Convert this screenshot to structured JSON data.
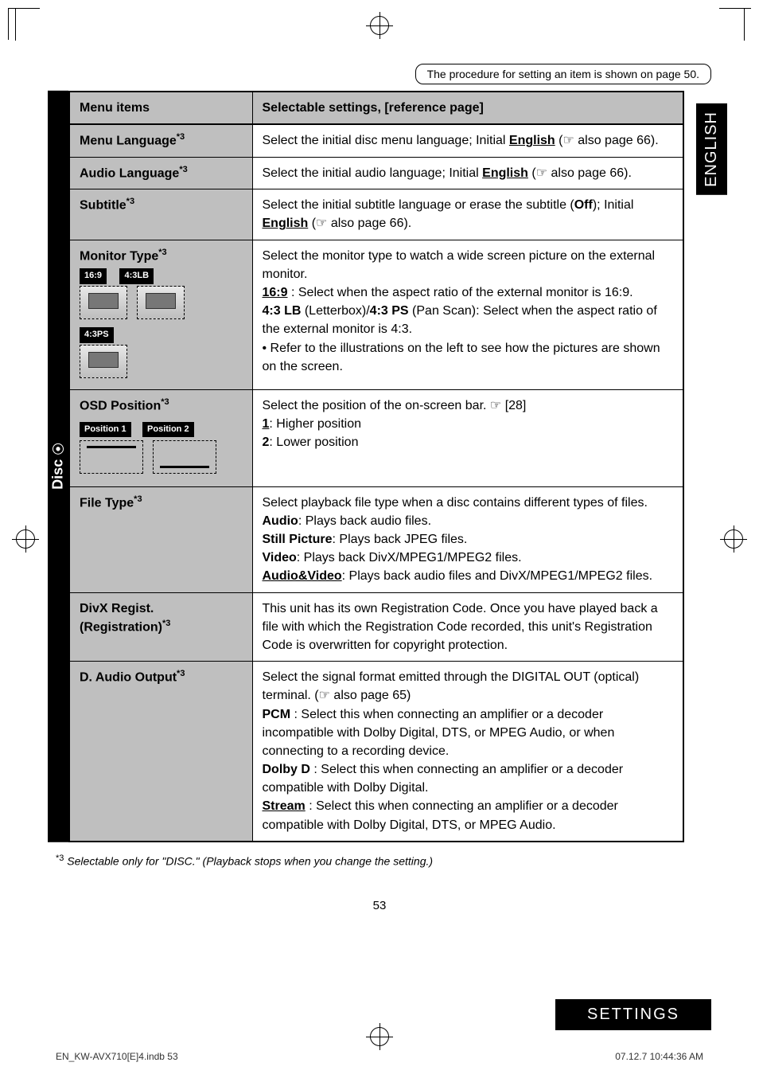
{
  "top_note": "The procedure for setting an item is shown on page 50.",
  "lang_tab": "ENGLISH",
  "side_label": "Disc",
  "header": {
    "col1": "Menu items",
    "col2": "Selectable settings, [reference page]"
  },
  "rows": {
    "menu_lang": {
      "key": "Menu Language",
      "sup": "*3",
      "body_a": "Select the initial disc menu language; Initial ",
      "body_link": "English",
      "body_b": " (☞ also page 66)."
    },
    "audio_lang": {
      "key": "Audio Language",
      "sup": "*3",
      "body_a": "Select the initial audio language; Initial ",
      "body_link": "English",
      "body_b": " (☞ also page 66)."
    },
    "subtitle": {
      "key": "Subtitle",
      "sup": "*3",
      "body_a": "Select the initial subtitle language or erase the subtitle (",
      "body_bold": "Off",
      "body_b": "); Initial ",
      "body_link": "English",
      "body_c": " (☞ also page 66)."
    },
    "monitor": {
      "key": "Monitor Type",
      "sup": "*3",
      "labels": {
        "r169": "16:9",
        "r43lb": "4:3LB",
        "r43ps": "4:3PS"
      },
      "l1": "Select the monitor type to watch a wide screen picture on the external monitor.",
      "l2a": "16:9",
      "l2b": " : Select when the aspect ratio of the external monitor is 16:9.",
      "l3a": "4:3 LB",
      "l3b": " (Letterbox)/",
      "l3c": "4:3 PS",
      "l3d": " (Pan Scan): Select when the aspect ratio of the external monitor is 4:3.",
      "bullet": "• Refer to the illustrations on the left to see how the pictures are shown on the screen."
    },
    "osd": {
      "key": "OSD Position",
      "sup": "*3",
      "pos1": "Position 1",
      "pos2": "Position 2",
      "l1": "Select the position of the on-screen bar. ☞ [28]",
      "l2a": "1",
      "l2b": ": Higher position",
      "l3a": "2",
      "l3b": ": Lower position"
    },
    "filetype": {
      "key": "File Type",
      "sup": "*3",
      "l1": "Select playback file type when a disc contains different types of files.",
      "l2a": "Audio",
      "l2b": ": Plays back audio files.",
      "l3a": "Still Picture",
      "l3b": ": Plays back JPEG files.",
      "l4a": "Video",
      "l4b": ": Plays back DivX/MPEG1/MPEG2 files.",
      "l5a": "Audio&Video",
      "l5b": ": Plays back audio files and DivX/MPEG1/MPEG2 files."
    },
    "divx": {
      "key": "DivX Regist. (Registration)",
      "sup": "*3",
      "body": "This unit has its own Registration Code. Once you have played back a file with which the Registration Code recorded, this unit's Registration Code is overwritten for copyright protection."
    },
    "daudio": {
      "key": "D. Audio Output",
      "sup": "*3",
      "l1": "Select the signal format emitted through the DIGITAL OUT (optical) terminal. (☞ also page 65)",
      "l2a": "PCM",
      "l2b": " : Select this when connecting an amplifier or a decoder incompatible with Dolby Digital, DTS, or MPEG Audio, or when connecting to a recording device.",
      "l3a": "Dolby D",
      "l3b": " : Select this when connecting an amplifier or a decoder compatible with Dolby Digital.",
      "l4a": "Stream",
      "l4b": " : Select this when connecting an amplifier or a decoder compatible with Dolby Digital, DTS, or MPEG Audio."
    }
  },
  "footnote_sup": "*3",
  "footnote": "Selectable only for \"DISC.\" (Playback stops when you change the setting.)",
  "page_number": "53",
  "settings_tab": "SETTINGS",
  "footer_left": "EN_KW-AVX710[E]4.indb   53",
  "footer_right": "07.12.7   10:44:36 AM"
}
